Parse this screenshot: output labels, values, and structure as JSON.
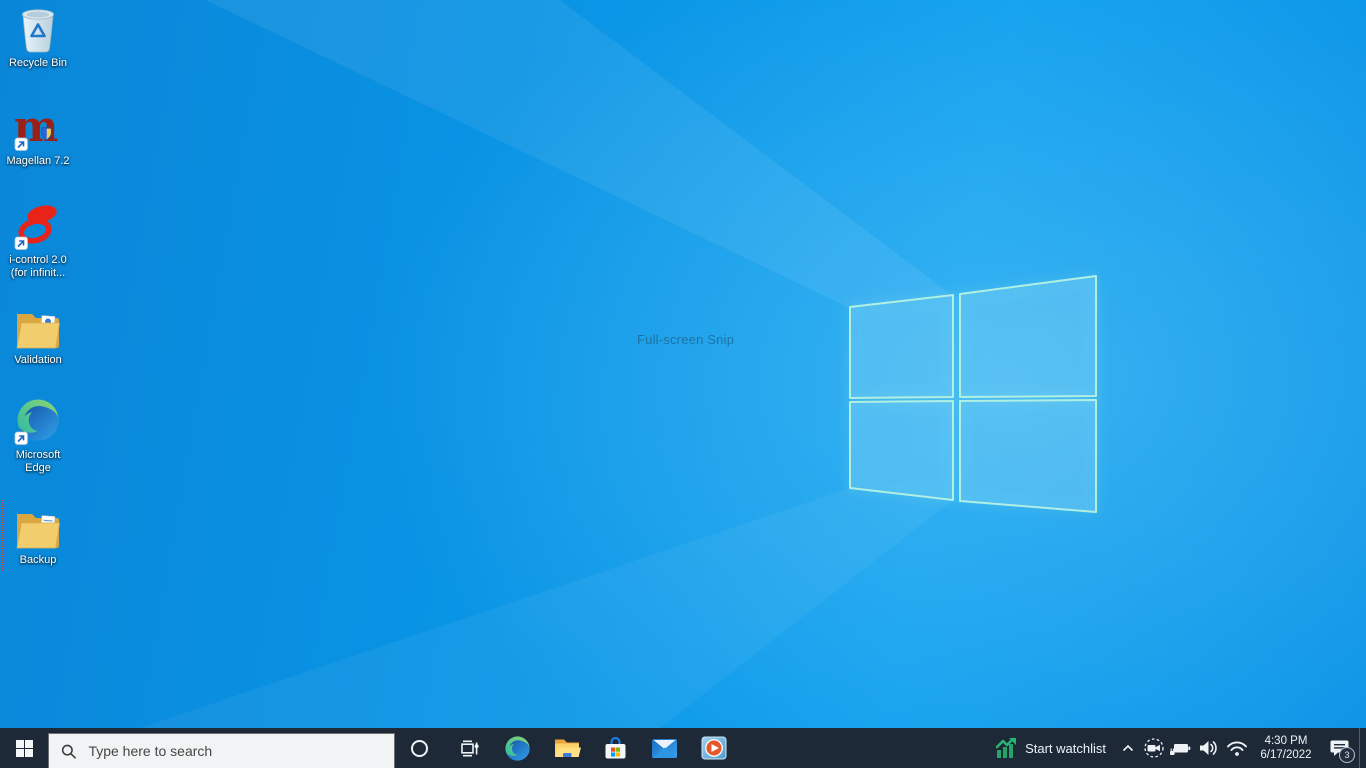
{
  "wallpaper": {
    "watermark": "Full-screen Snip"
  },
  "glyphs": {
    "magellan_m": "m"
  },
  "desktop_icons": [
    {
      "id": "recycle-bin",
      "label": "Recycle Bin"
    },
    {
      "id": "magellan",
      "label": "Magellan 7.2"
    },
    {
      "id": "i-control",
      "label": "i-control 2.0",
      "label2": "(for infinit..."
    },
    {
      "id": "validation",
      "label": "Validation"
    },
    {
      "id": "microsoft-edge",
      "label": "Microsoft",
      "label2": "Edge"
    },
    {
      "id": "backup",
      "label": "Backup",
      "selected": true
    }
  ],
  "taskbar": {
    "search": {
      "placeholder": "Type here to search"
    },
    "pinned": [
      "cortana",
      "task-view",
      "edge",
      "file-explorer",
      "store",
      "mail",
      "media-player"
    ],
    "tray": {
      "watchlist_label": "Start watchlist",
      "time": "4:30 PM",
      "date": "6/17/2022",
      "notification_badge": "3"
    }
  },
  "colors": {
    "wallpaper_blue": "#0a93e4",
    "taskbar_bg": "#1d2937",
    "selection_dotted_red": "#dd4330",
    "watchlist_green": "#22a566",
    "search_box_bg": "#f2f3f4"
  }
}
